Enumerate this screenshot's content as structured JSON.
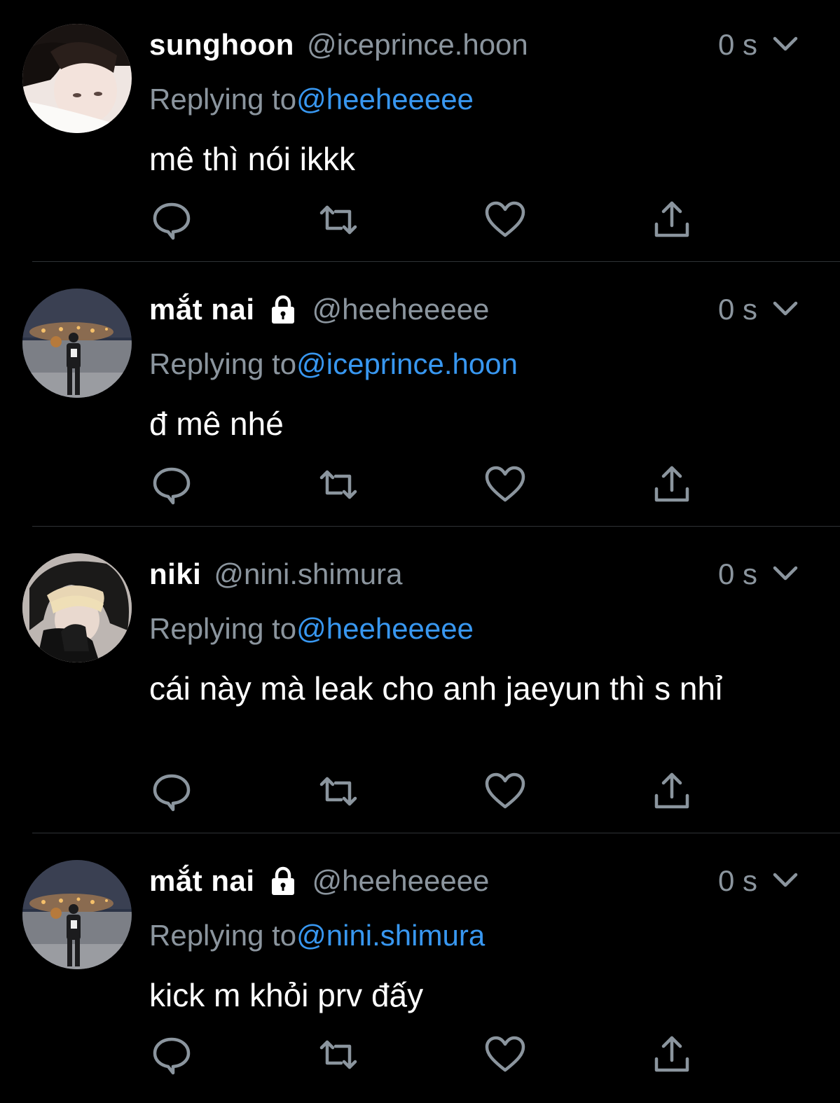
{
  "tweets": [
    {
      "name": "sunghoon",
      "handle": "@iceprince.hoon",
      "locked": false,
      "time": "0 s",
      "reply_prefix": "Replying to",
      "reply_to": "@heeheeeee",
      "text": "mê thì nói ikkk"
    },
    {
      "name": "mắt nai",
      "handle": "@heeheeeee",
      "locked": true,
      "time": "0 s",
      "reply_prefix": "Replying to",
      "reply_to": "@iceprince.hoon",
      "text": "đ mê nhé"
    },
    {
      "name": "niki",
      "handle": "@nini.shimura",
      "locked": false,
      "time": "0 s",
      "reply_prefix": "Replying to",
      "reply_to": "@heeheeeee",
      "text": "cái này mà leak cho anh jaeyun thì s nhỉ"
    },
    {
      "name": "mắt nai",
      "handle": "@heeheeeee",
      "locked": true,
      "time": "0 s",
      "reply_prefix": "Replying to",
      "reply_to": "@nini.shimura",
      "text": "kick m khỏi prv đấy"
    }
  ],
  "icons": {
    "reply": "comment-bubble-icon",
    "retweet": "retweet-icon",
    "like": "heart-icon",
    "share": "share-upload-icon",
    "menu": "chevron-down-icon",
    "protected": "lock-icon"
  },
  "colors": {
    "background": "#000000",
    "text": "#ffffff",
    "secondary": "#8b959e",
    "link": "#3897f0",
    "divider": "#2f3336"
  }
}
